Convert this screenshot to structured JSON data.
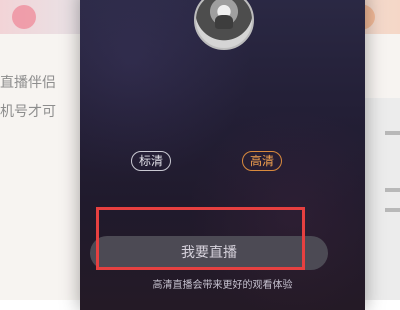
{
  "background": {
    "left_text_1": "直播伴侣",
    "left_text_2": "机号才可"
  },
  "overlay": {
    "profile": {
      "name": "",
      "subtitle": ""
    },
    "quality": {
      "standard_label": "标清",
      "hd_label": "高清"
    },
    "primary_action": "我要直播",
    "hint": "高清直播会带来更好的观看体验"
  },
  "colors": {
    "highlight_border": "#e64040",
    "hd_accent": "#f3a24f",
    "overlay_bg": "#231f36"
  }
}
